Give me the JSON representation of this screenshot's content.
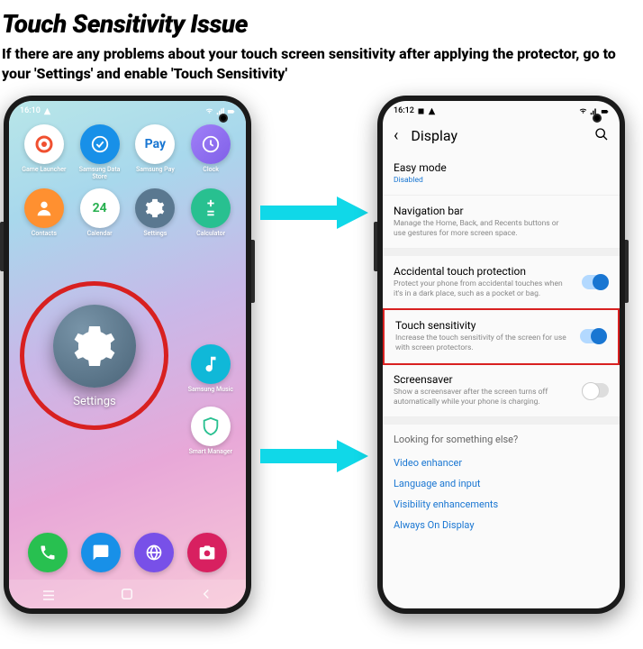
{
  "heading": "Touch Sensitivity Issue",
  "subheading": "If there are any problems about your touch screen sensitivity after applying the protector, go to your 'Settings' and enable 'Touch Sensitivity'",
  "left_phone": {
    "time": "16:10",
    "apps": [
      {
        "label": "Game Launcher",
        "bg": "#fff",
        "fg": "#f05030"
      },
      {
        "label": "Samsung Data Store",
        "bg": "#1890e8",
        "fg": "#fff"
      },
      {
        "label": "Samsung Pay",
        "bg": "#fff",
        "fg": "#1976d2",
        "text": "Pay"
      },
      {
        "label": "Clock",
        "bg": "linear-gradient(135deg,#a080f8,#8060e8)",
        "fg": "#fff"
      },
      {
        "label": "Contacts",
        "bg": "#ff9030",
        "fg": "#fff"
      },
      {
        "label": "Calendar",
        "bg": "#fff",
        "fg": "#28b050",
        "text": "24"
      },
      {
        "label": "Settings",
        "bg": "#5a7890",
        "fg": "#fff"
      },
      {
        "label": "Calculator",
        "bg": "#28c090",
        "fg": "#fff"
      }
    ],
    "side_apps": [
      {
        "label": "Samsung Music",
        "bg": "#10b8d8"
      },
      {
        "label": "Smart Manager",
        "bg": "#fff"
      }
    ],
    "settings_label": "Settings"
  },
  "right_phone": {
    "time": "16:12",
    "screen_title": "Display",
    "items": [
      {
        "title": "Easy mode",
        "sub": "Disabled",
        "subBlue": true
      },
      {
        "title": "Navigation bar",
        "sub": "Manage the Home, Back, and Recents buttons or use gestures for more screen space."
      },
      {
        "title": "Accidental touch protection",
        "sub": "Protect your phone from accidental touches when it's in a dark place, such as a pocket or bag.",
        "toggle": "on"
      },
      {
        "title": "Touch sensitivity",
        "sub": "Increase the touch sensitivity of the screen for use with screen protectors.",
        "toggle": "on",
        "highlight": true
      },
      {
        "title": "Screensaver",
        "sub": "Show a screensaver after the screen turns off automatically while your phone is charging.",
        "toggle": "off"
      }
    ],
    "looking_title": "Looking for something else?",
    "looking_links": [
      "Video enhancer",
      "Language and input",
      "Visibility enhancements",
      "Always On Display"
    ]
  }
}
